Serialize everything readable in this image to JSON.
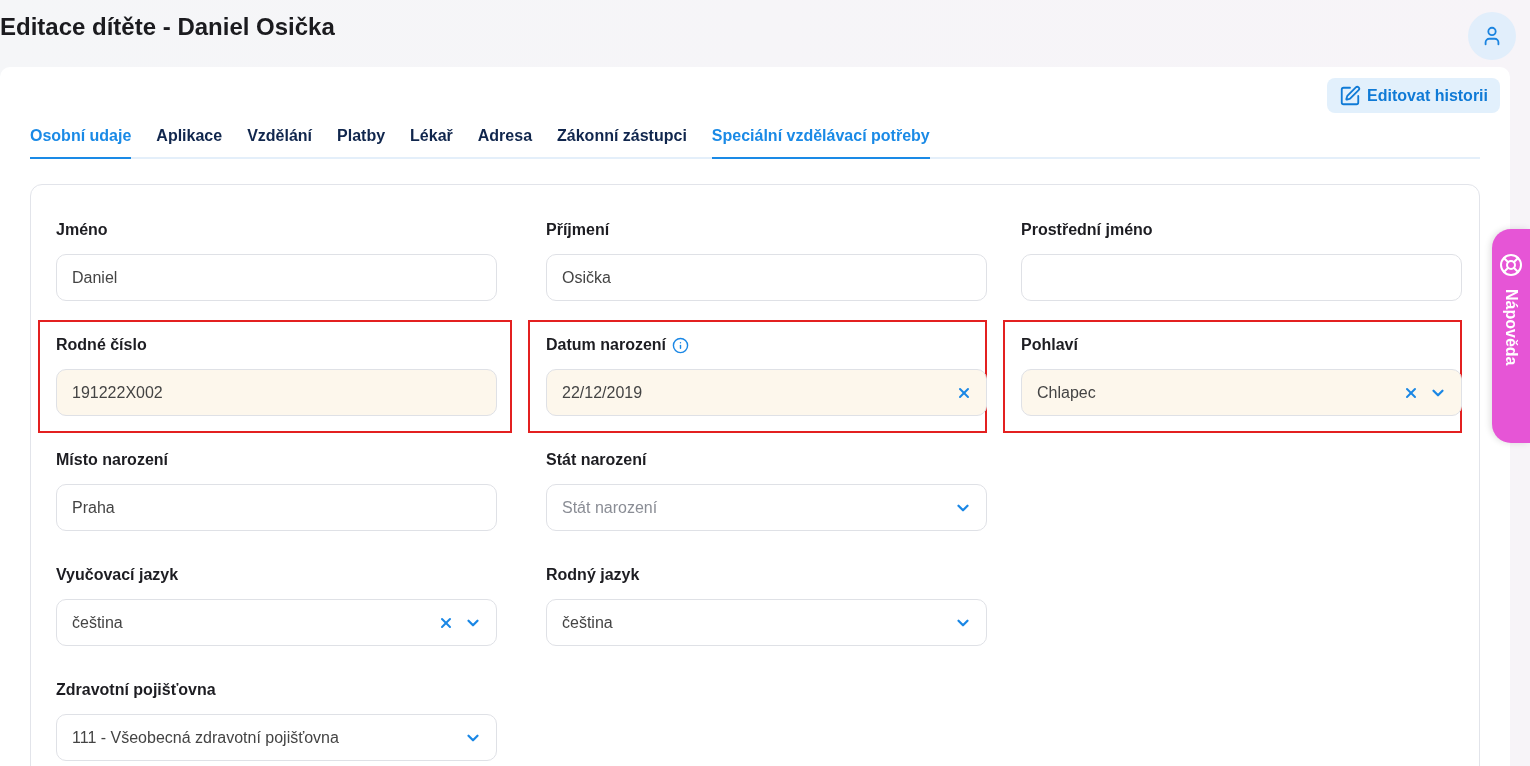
{
  "page": {
    "title": "Editace dítěte - Daniel Osička"
  },
  "toolbar": {
    "edit_button": "Editovat historii"
  },
  "tabs": [
    {
      "label": "Osobní udaje",
      "selected": true
    },
    {
      "label": "Aplikace",
      "selected": false
    },
    {
      "label": "Vzdělání",
      "selected": false
    },
    {
      "label": "Platby",
      "selected": false
    },
    {
      "label": "Lékař",
      "selected": false
    },
    {
      "label": "Adresa",
      "selected": false
    },
    {
      "label": "Zákonní zástupci",
      "selected": false
    },
    {
      "label": "Speciální vzdělávací potřeby",
      "selected": true
    }
  ],
  "form": {
    "rows": [
      [
        {
          "kind": "text",
          "label": "Jméno",
          "value": "Daniel",
          "prefilled": false,
          "highlighted": false
        },
        {
          "kind": "text",
          "label": "Příjmení",
          "value": "Osička",
          "prefilled": false,
          "highlighted": false
        },
        {
          "kind": "text",
          "label": "Prostřední jméno",
          "prefilled": false,
          "highlighted": false
        }
      ],
      [
        {
          "kind": "text",
          "label": "Rodné číslo",
          "value": "191222X002",
          "prefilled": true,
          "highlighted": true
        },
        {
          "kind": "date",
          "label": "Datum narození",
          "value": "22/12/2019",
          "info": true,
          "clearable": true,
          "prefilled": true,
          "highlighted": true
        },
        {
          "kind": "select",
          "label": "Pohlaví",
          "value": "Chlapec",
          "clearable": true,
          "prefilled": true,
          "highlighted": true
        }
      ],
      [
        {
          "kind": "text",
          "label": "Místo narození",
          "value": "Praha",
          "prefilled": false,
          "highlighted": false
        },
        {
          "kind": "select",
          "label": "Stát narození",
          "placeholder": "Stát narození",
          "clearable": false,
          "prefilled": false,
          "highlighted": false
        }
      ],
      [
        {
          "kind": "select",
          "label": "Vyučovací jazyk",
          "value": "čeština",
          "clearable": true,
          "prefilled": false,
          "highlighted": false
        },
        {
          "kind": "select",
          "label": "Rodný jazyk",
          "value": "čeština",
          "clearable": false,
          "prefilled": false,
          "highlighted": false
        }
      ],
      [
        {
          "kind": "select",
          "label": "Zdravotní pojišťovna",
          "value": "111 - Všeobecná zdravotní pojišťovna",
          "clearable": false,
          "prefilled": false,
          "highlighted": false
        }
      ]
    ]
  },
  "help_tab": {
    "label": "Nápověda"
  }
}
